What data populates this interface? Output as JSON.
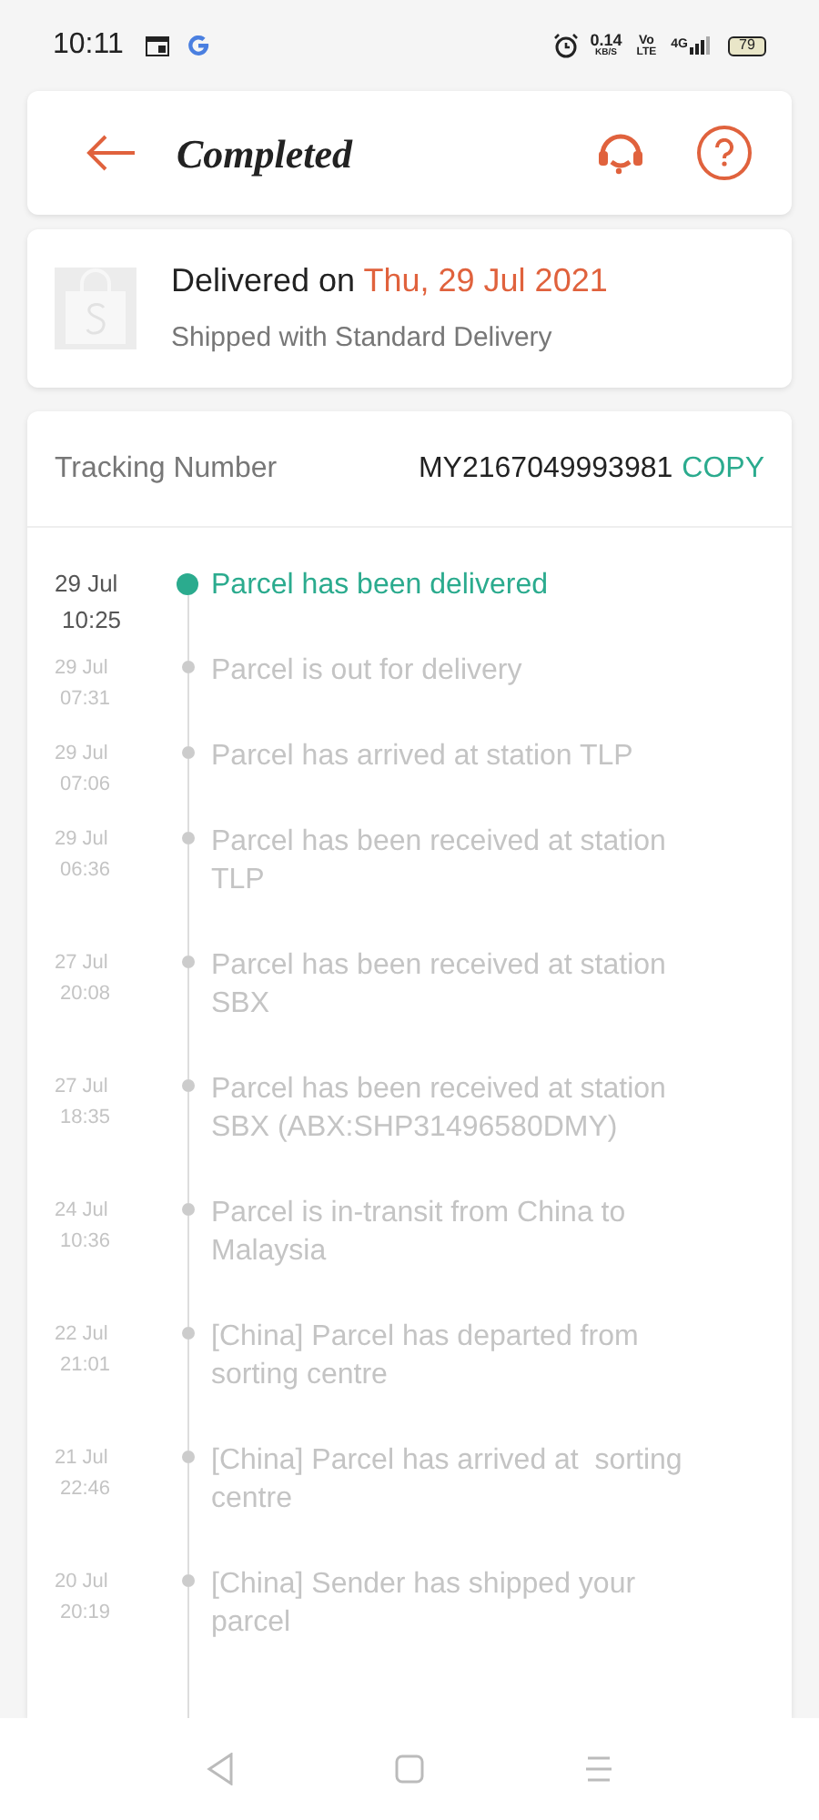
{
  "status_bar": {
    "time": "10:11",
    "speed": "0.14",
    "speed_unit": "KB/S",
    "volte_top": "Vo",
    "volte_bottom": "LTE",
    "network": "4G",
    "battery": "79"
  },
  "header": {
    "title": "Completed"
  },
  "delivery": {
    "prefix": "Delivered on",
    "date": "Thu, 29 Jul 2021",
    "method": "Shipped with Standard Delivery"
  },
  "tracking": {
    "label": "Tracking Number",
    "number": "MY2167049993981",
    "copy": "COPY"
  },
  "events": [
    {
      "date": "29 Jul",
      "time": "10:25",
      "text": "Parcel has been delivered",
      "current": true
    },
    {
      "date": "29 Jul",
      "time": "07:31",
      "text": "Parcel is out for delivery",
      "current": false
    },
    {
      "date": "29 Jul",
      "time": "07:06",
      "text": "Parcel has arrived at station TLP",
      "current": false
    },
    {
      "date": "29 Jul",
      "time": "06:36",
      "text": "Parcel has been received at station TLP",
      "current": false
    },
    {
      "date": "27 Jul",
      "time": "20:08",
      "text": "Parcel has been received at station SBX",
      "current": false
    },
    {
      "date": "27 Jul",
      "time": "18:35",
      "text": "Parcel has been received at station SBX (ABX:SHP31496580DMY)",
      "current": false
    },
    {
      "date": "24 Jul",
      "time": "10:36",
      "text": "Parcel is in-transit from China to Malaysia",
      "current": false
    },
    {
      "date": "22 Jul",
      "time": "21:01",
      "text": "[China] Parcel has departed from sorting centre",
      "current": false
    },
    {
      "date": "21 Jul",
      "time": "22:46",
      "text": "[China] Parcel has arrived at  sorting centre",
      "current": false
    },
    {
      "date": "20 Jul",
      "time": "20:19",
      "text": "[China] Sender has shipped your parcel",
      "current": false
    }
  ]
}
